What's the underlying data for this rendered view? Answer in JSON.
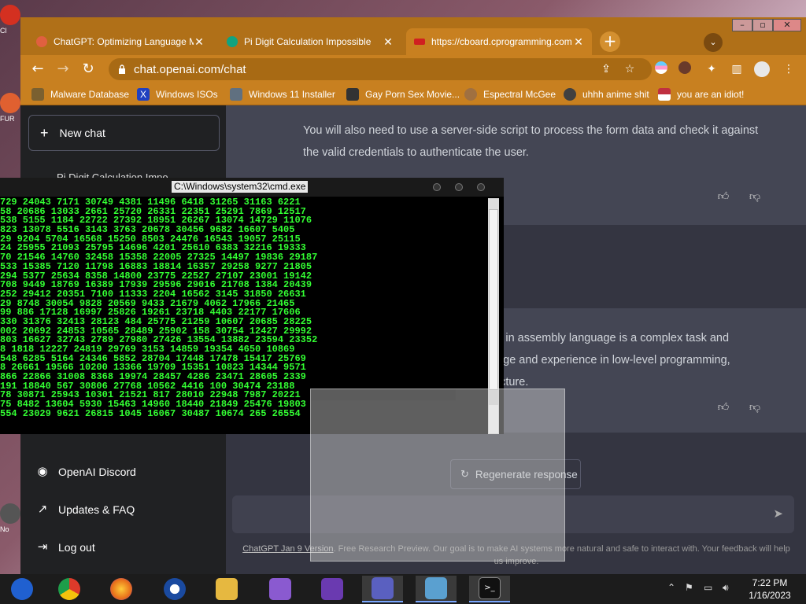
{
  "desktop": {
    "icons": [
      {
        "label": "Cl",
        "color": "#d43020"
      },
      {
        "label": "FUR",
        "color": "#e06030"
      },
      {
        "label": "No",
        "color": "#555555"
      }
    ]
  },
  "browser": {
    "tabs": [
      {
        "title": "ChatGPT: Optimizing Language Mo",
        "icon": "chatgpt-icon",
        "icon_color": "#e06040",
        "active": false
      },
      {
        "title": "Pi Digit Calculation Impossible",
        "icon": "chatgpt-icon",
        "icon_color": "#10a37f",
        "active": false
      },
      {
        "title": "https://cboard.cprogramming.com",
        "icon": "cboard-icon",
        "icon_color": "#d02020",
        "active": true
      }
    ],
    "new_tab": "+",
    "tab_menu": "⌄",
    "window_controls": [
      "–",
      "▫",
      "✕"
    ],
    "url": "chat.openai.com/chat",
    "bookmarks": [
      {
        "label": "Malware Database",
        "icon": "bug-icon",
        "color": "#7a6030"
      },
      {
        "label": "Windows ISOs",
        "icon": "x-icon",
        "color": "#2040c0"
      },
      {
        "label": "Windows 11 Installer",
        "icon": "installer-icon",
        "color": "#607080"
      },
      {
        "label": "Gay Porn Sex Movie...",
        "icon": "page-icon",
        "color": "#333333"
      },
      {
        "label": "Espectral McGee",
        "icon": "avatar-icon",
        "color": "#a07040"
      },
      {
        "label": "uhhh anime shit",
        "icon": "anime-icon",
        "color": "#404040"
      },
      {
        "label": "you are an idiot!",
        "icon": "flag-icon",
        "color": "#c03040"
      }
    ]
  },
  "chatgpt": {
    "new_chat": "New chat",
    "chat_item": "Pi Digit Calculation Impo",
    "sidebar_links": [
      {
        "label": "OpenAI Discord",
        "icon": "discord-icon"
      },
      {
        "label": "Updates & FAQ",
        "icon": "external-link-icon"
      },
      {
        "label": "Log out",
        "icon": "logout-icon"
      }
    ],
    "message_top": [
      "You will also need to use a server-side script to process the form data and check it against",
      "the valid credentials to authenticate the user."
    ],
    "message_bottom": [
      "ch in assembly language is a complex task and",
      "edge and experience in low-level programming,",
      "tecture."
    ],
    "regenerate": "Regenerate response",
    "footer_link": "ChatGPT Jan 9 Version",
    "footer_text": ". Free Research Preview. Our goal is to make AI systems more natural and safe to interact with. Your feedback will help us improve."
  },
  "cmd": {
    "title": "C:\\Windows\\system32\\cmd.exe",
    "lines": [
      "729 24043 7171 30749 4381 11496 6418 31265 31163 6221",
      "58 20686 13033 2661 25720 26331 22351 25291 7869 12517",
      "538 5155 1184 22722 27392 18951 26267 13074 14729 11076",
      "823 13078 5516 3143 3763 20678 30456 9682 16607 5405",
      "29 9204 5704 16568 15250 8503 24476 16543 19057 25115",
      "24 25955 21093 25795 14696 4201 25610 6383 32216 19333",
      "70 21546 14760 32458 15358 22005 27325 14497 19836 29187",
      "533 15385 7120 11798 16883 18814 16357 29258 9277 21805",
      "294 5377 25634 8358 14800 23775 22527 27107 23001 19142",
      "708 9449 18769 16389 17939 29596 29016 21708 1384 20439",
      "252 29412 20351 7100 11333 2204 16562 3145 31850 26631",
      "29 8748 30054 9828 20569 9433 21679 4062 17966 21465",
      "99 886 17128 16997 25826 19261 23718 4403 22177 17606",
      "330 31376 32413 28123 484 25775 21259 10607 20685 28225",
      "002 20692 24853 10565 28489 25902 158 30754 12427 29992",
      "803 16627 32743 2789 27980 27426 13554 13882 23594 23352",
      "8 1818 12227 24819 29769 3153 14859 19354 4650 10869",
      "548 6285 5164 24346 5852 28704 17448 17478 15417 25769",
      "8 26661 19566 10200 13366 19709 15351 10823 14344 9571",
      "866 22866 31008 8368 19974 28457 4286 23471 28605 2339",
      "191 18840 567 30806 27768 10562 4416 100 30474 23188",
      "78 30871 25943 10301 21521 817 28010 22948 7987 20221",
      "75 8482 13604 5930 15463 14960 18440 21849 25476 19803",
      "554 23029 9621 26815 1045 16067 30487 10674 265 26554"
    ]
  },
  "taskbar": {
    "apps": [
      {
        "name": "taskbar-app-chrome-alt",
        "color": "#2060d0"
      },
      {
        "name": "taskbar-app-chrome",
        "color": "#dd3a2a"
      },
      {
        "name": "taskbar-app-firefox",
        "color": "#e8701a"
      },
      {
        "name": "taskbar-app-obama",
        "color": "#1a4aa0"
      },
      {
        "name": "taskbar-app-explorer",
        "color": "#e6b840"
      },
      {
        "name": "taskbar-app-visual-studio-installer",
        "color": "#8a5ad0"
      },
      {
        "name": "taskbar-app-visual-studio",
        "color": "#6a3ab0"
      },
      {
        "name": "taskbar-app-teams",
        "color": "#5a60c0"
      },
      {
        "name": "taskbar-app-screen-sketch",
        "color": "#5aa0d0"
      },
      {
        "name": "taskbar-app-cmd",
        "color": "#111111"
      }
    ],
    "time": "7:22 PM",
    "date": "1/16/2023"
  }
}
